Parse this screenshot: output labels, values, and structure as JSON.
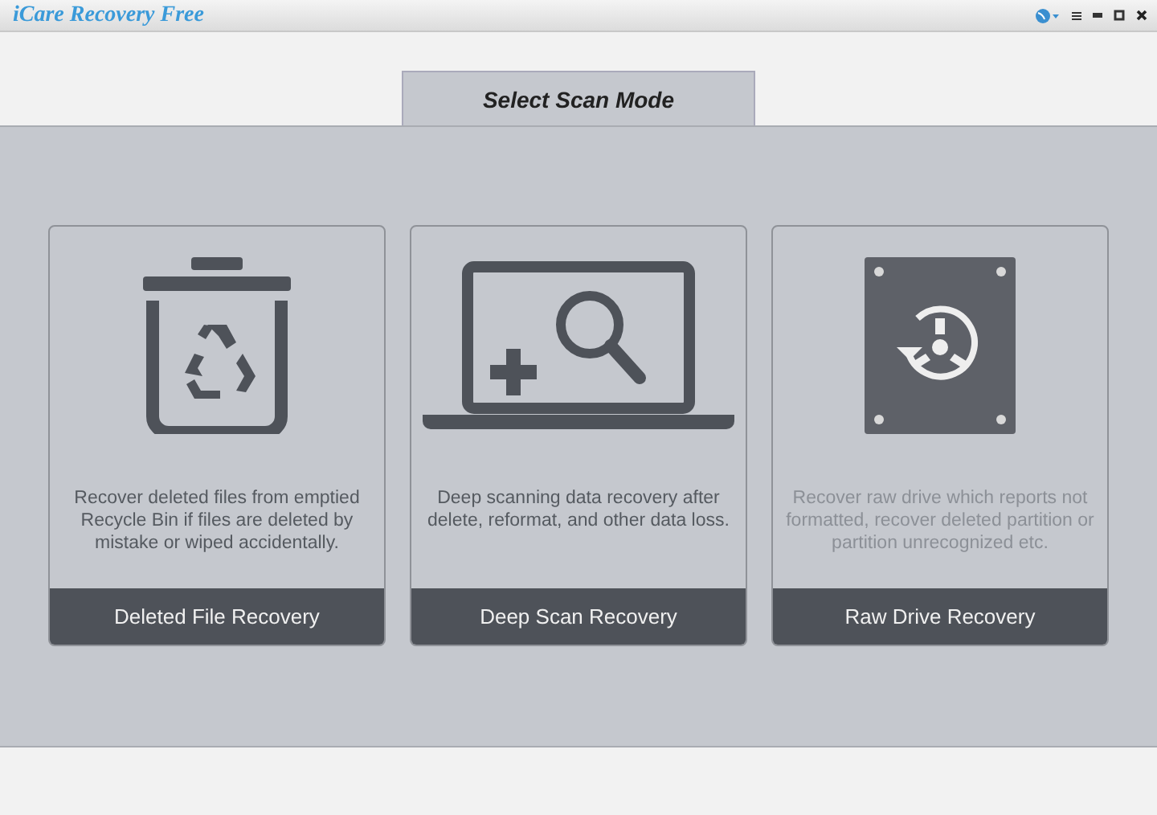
{
  "window": {
    "title": "iCare Recovery Free"
  },
  "tab": {
    "label": "Select Scan Mode",
    "selected": true
  },
  "cards": [
    {
      "kind": "recycle",
      "description": "Recover deleted files from emptied Recycle Bin if files are deleted by mistake or wiped accidentally.",
      "button": "Deleted File Recovery",
      "dimmed": false
    },
    {
      "kind": "deep",
      "description": "Deep scanning data recovery after delete, reformat, and other data loss.",
      "button": "Deep Scan Recovery",
      "dimmed": false
    },
    {
      "kind": "raw",
      "description": "Recover raw drive which reports not formatted, recover deleted partition or partition unrecognized etc.",
      "button": "Raw Drive Recovery",
      "dimmed": true
    }
  ]
}
